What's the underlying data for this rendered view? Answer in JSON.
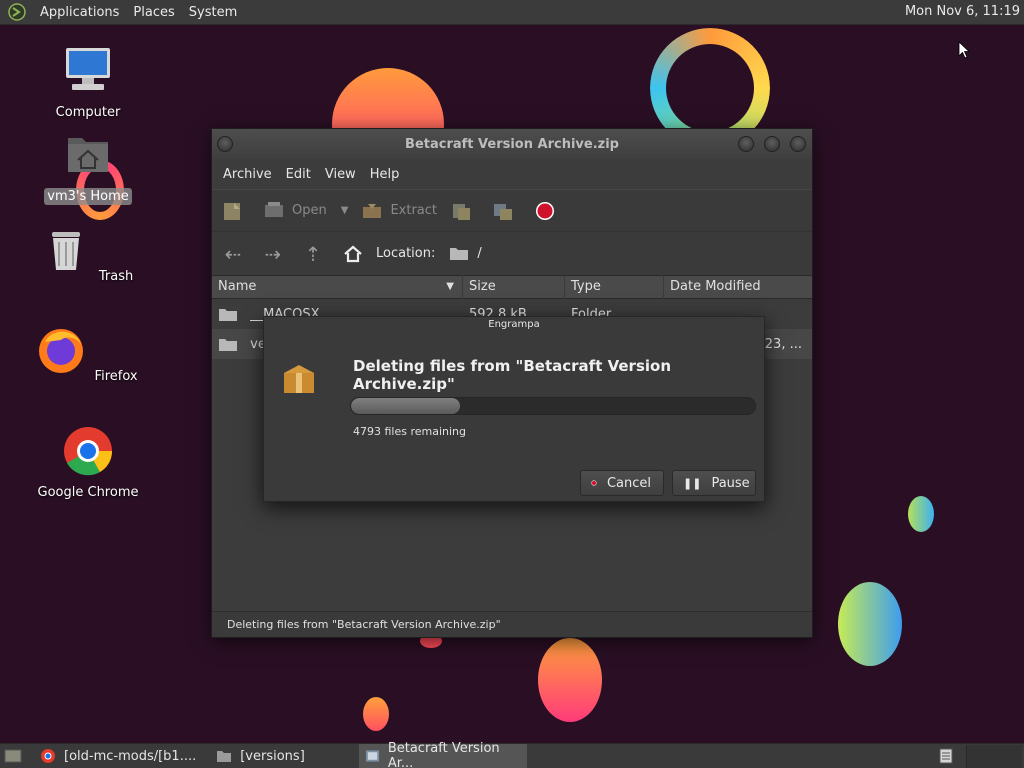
{
  "top_panel": {
    "menus": [
      "Applications",
      "Places",
      "System"
    ],
    "clock": "Mon Nov  6, 11:19"
  },
  "desktop": {
    "icons": [
      {
        "label": "Computer",
        "icon": "computer-icon"
      },
      {
        "label": "vm3's Home",
        "icon": "home-folder-icon"
      },
      {
        "label": "Trash",
        "icon": "trash-icon"
      },
      {
        "label": "Firefox",
        "icon": "firefox-icon"
      },
      {
        "label": "Google Chrome",
        "icon": "chrome-icon"
      }
    ]
  },
  "window": {
    "title": "Betacraft Version Archive.zip",
    "menus": [
      "Archive",
      "Edit",
      "View",
      "Help"
    ],
    "toolbar": {
      "open_label": "Open",
      "extract_label": "Extract"
    },
    "location": {
      "label": "Location:",
      "path": "/"
    },
    "columns": [
      "Name",
      "Size",
      "Type",
      "Date Modified"
    ],
    "rows": [
      {
        "name": "__MACOSX",
        "size": "592.8 kB",
        "type": "Folder",
        "date": ""
      },
      {
        "name": "ver",
        "size": "",
        "type": "",
        "date": "023, ..."
      }
    ],
    "status": "Deleting files from \"Betacraft Version Archive.zip\""
  },
  "dialog": {
    "title": "Engrampa",
    "heading": "Deleting files from \"Betacraft Version Archive.zip\"",
    "progress": 0.27,
    "remaining": "4793 files remaining",
    "cancel_label": "Cancel",
    "pause_label": "Pause"
  },
  "taskbar": {
    "tasks": [
      {
        "label": "[old-mc-mods/[b1....",
        "icon": "chrome-icon"
      },
      {
        "label": "[versions]",
        "icon": "folder-icon"
      },
      {
        "label": "Betacraft Version Ar...",
        "icon": "archive-icon"
      }
    ]
  },
  "colors": {
    "desktop_bg": "#2a0f24",
    "panel_bg": "#3b3b3b",
    "window_bg": "#3c3c3c",
    "stop_red": "#d0112b"
  }
}
